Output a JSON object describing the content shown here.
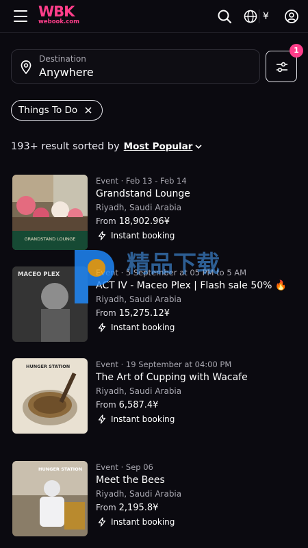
{
  "header": {
    "logo_mark": "WBK",
    "logo_sub": "webook.com",
    "currency_symbol": "¥",
    "icons": [
      "menu-icon",
      "search-icon",
      "globe-icon",
      "account-icon"
    ]
  },
  "search": {
    "destination_label": "Destination",
    "destination_value": "Anywhere",
    "filter_count": "1"
  },
  "filters": {
    "chips": [
      {
        "label": "Things To Do"
      }
    ]
  },
  "results": {
    "count_text": "193+ result sorted by",
    "sort_label": "Most Popular"
  },
  "events": [
    {
      "meta": "Event · Feb 13 - Feb 14",
      "title": "Grandstand Lounge",
      "location": "Riyadh, Saudi Arabia",
      "price_prefix": "From",
      "price": "18,902.96¥",
      "booking": "Instant booking",
      "image_text": "GRANDSTAND LOUNGE"
    },
    {
      "meta": "Event · 5 September at 05 PM to 5 AM",
      "title": "ACT IV - Maceo Plex | Flash sale 50% 🔥",
      "location": "Riyadh, Saudi Arabia",
      "price_prefix": "From",
      "price": "15,275.12¥",
      "booking": "Instant booking",
      "image_text": "MACEO PLEX"
    },
    {
      "meta": "Event · 19 September at 04:00 PM",
      "title": "The Art of Cupping with Wacafe",
      "location": "Riyadh, Saudi Arabia",
      "price_prefix": "From",
      "price": "6,587.4¥",
      "booking": "Instant booking",
      "image_text": "HUNGER STATION"
    },
    {
      "meta": "Event · Sep 06",
      "title": "Meet the Bees",
      "location": "Riyadh, Saudi Arabia",
      "price_prefix": "From",
      "price": "2,195.8¥",
      "booking": "Instant booking",
      "image_text": "HUNGER STATION"
    }
  ],
  "watermark": {
    "text": "精品下载"
  },
  "colors": {
    "background": "#0b0a10",
    "brand": "#ff3e8a",
    "muted_text": "#a9a8b1"
  }
}
